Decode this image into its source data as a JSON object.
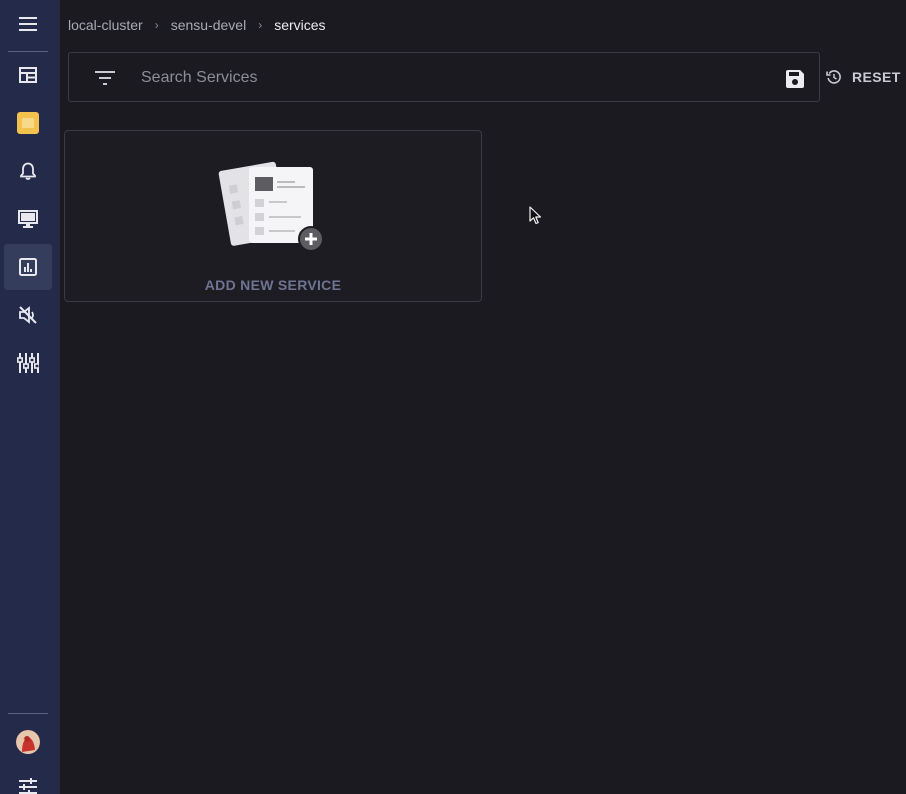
{
  "breadcrumb": {
    "items": [
      "local-cluster",
      "sensu-devel",
      "services"
    ],
    "separator": "›"
  },
  "search": {
    "placeholder": "Search Services",
    "value": ""
  },
  "toolbar": {
    "reset_label": "RESET"
  },
  "card": {
    "label": "ADD NEW SERVICE"
  },
  "sidebar": {
    "items": [
      {
        "name": "menu",
        "icon": "hamburger-menu-icon"
      },
      {
        "name": "dashboard",
        "icon": "dashboard-icon"
      },
      {
        "name": "namespace",
        "icon": "namespace-tile-icon"
      },
      {
        "name": "events",
        "icon": "bell-icon"
      },
      {
        "name": "entities",
        "icon": "monitor-icon"
      },
      {
        "name": "services",
        "icon": "bar-chart-icon",
        "active": true
      },
      {
        "name": "silences",
        "icon": "volume-off-icon"
      },
      {
        "name": "configuration",
        "icon": "equalizer-icon"
      },
      {
        "name": "account",
        "icon": "avatar-icon"
      },
      {
        "name": "preferences",
        "icon": "tune-icon"
      }
    ]
  },
  "colors": {
    "background": "#1a1a20",
    "sidebar": "#232a4a",
    "sidebar_active": "#353d5d",
    "namespace_accent": "#f2c14e",
    "card_label": "#6e7492"
  }
}
